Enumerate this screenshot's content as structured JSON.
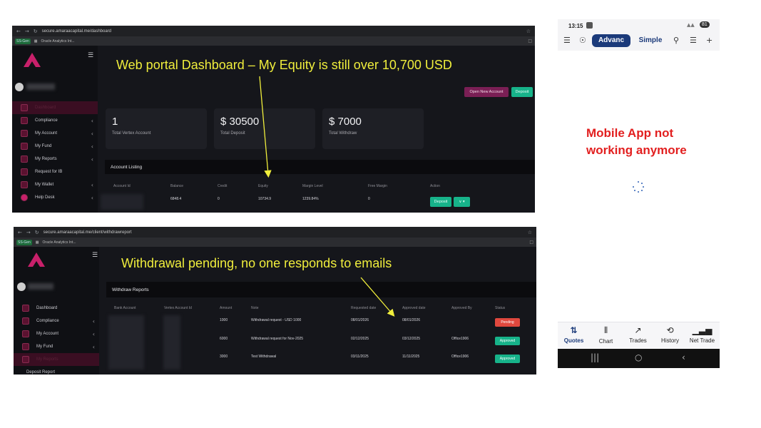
{
  "annotations": {
    "dashboard": "Web portal Dashboard – My Equity is still over 10,700 USD",
    "withdrawal": "Withdrawal pending, no one responds to emails",
    "mobile": "Mobile App not working anymore"
  },
  "dashboard": {
    "url": "secure.amaraacapital.me/dashboard",
    "bookmark_tag": "SS-Gen",
    "bookmark_item": "Oracle Analytics Int...",
    "sidebar": [
      {
        "label": "Dashboard",
        "chevron": ""
      },
      {
        "label": "Compliance",
        "chevron": "‹"
      },
      {
        "label": "My Account",
        "chevron": "‹"
      },
      {
        "label": "My Fund",
        "chevron": "‹"
      },
      {
        "label": "My Reports",
        "chevron": "‹"
      },
      {
        "label": "Request for IB",
        "chevron": ""
      },
      {
        "label": "My Wallet",
        "chevron": "‹"
      },
      {
        "label": "Help Desk",
        "chevron": "‹"
      }
    ],
    "buttons": {
      "open_account": "Open New Account",
      "deposit": "Deposit"
    },
    "cards": [
      {
        "value": "1",
        "label": "Total Vertex Account"
      },
      {
        "value": "$ 30500",
        "label": "Total Deposit"
      },
      {
        "value": "$ 7000",
        "label": "Total Withdraw"
      }
    ],
    "listing_title": "Account Listing",
    "columns": [
      "Account Id",
      "Balance",
      "Credit",
      "Equity",
      "Margin Level",
      "Free Margin",
      "Action"
    ],
    "row": {
      "balance": "6848.4",
      "credit": "0",
      "equity": "10734.9",
      "margin_level": "1239.84%",
      "free_margin": "0",
      "action": "Deposit",
      "menu": "∨ ▾"
    }
  },
  "withdraw": {
    "url": "secure.amaraacapital.me/client/withdrawreport",
    "bookmark_tag": "SS-Gen",
    "bookmark_item": "Oracle Analytics Int...",
    "sidebar": [
      {
        "label": "Dashboard",
        "chevron": ""
      },
      {
        "label": "Compliance",
        "chevron": "‹"
      },
      {
        "label": "My Account",
        "chevron": "‹"
      },
      {
        "label": "My Fund",
        "chevron": "‹"
      },
      {
        "label": "My Reports",
        "chevron": ""
      },
      {
        "label": "Deposit Report",
        "chevron": ""
      }
    ],
    "panel_title": "Withdraw Reports",
    "columns": [
      "Bank Account",
      "Vertex Account Id",
      "Amount",
      "Note",
      "Requested date",
      "Approved date",
      "Approved By",
      "Status"
    ],
    "rows": [
      {
        "amount": "1000",
        "note": "Withdrawal request - USD 1000",
        "requested": "08/01/2026",
        "approved": "08/01/2026",
        "by": "",
        "status": "Pending",
        "color": "#e0483e"
      },
      {
        "amount": "6000",
        "note": "Withdrawal request for Nov-2025",
        "requested": "02/12/2025",
        "approved": "03/12/2025",
        "by": "Office1906",
        "status": "Approved",
        "color": "#17b38a"
      },
      {
        "amount": "3000",
        "note": "Test Withdrawal",
        "requested": "03/11/2025",
        "approved": "11/11/2025",
        "by": "Office1906",
        "status": "Approved",
        "color": "#17b38a"
      }
    ]
  },
  "phone": {
    "time": "13:15",
    "battery": "81",
    "tabs_top": {
      "advanced": "Advanc",
      "simple": "Simple"
    },
    "message": "Mobile App not working anymore",
    "bottom_tabs": [
      {
        "icon": "⇅",
        "label": "Quotes"
      },
      {
        "icon": "⫴",
        "label": "Chart"
      },
      {
        "icon": "↗",
        "label": "Trades"
      },
      {
        "icon": "⟲",
        "label": "History"
      },
      {
        "icon": "▁▃▅",
        "label": "Net Trade"
      }
    ],
    "nav": {
      "recents": "|||",
      "home": "○",
      "back": "‹"
    }
  }
}
